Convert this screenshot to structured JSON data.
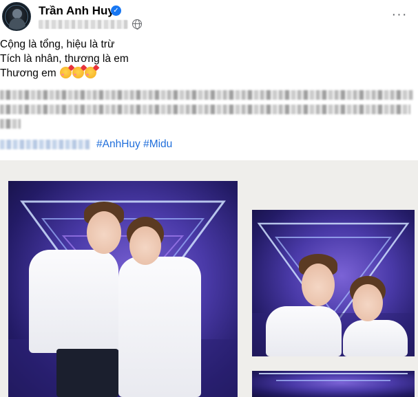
{
  "post": {
    "author": "Trần Anh Huy",
    "verified_icon": "verified-badge-icon",
    "privacy_icon": "globe-icon",
    "more_label": "···",
    "text_lines": [
      "Cộng là tổng, hiệu là trừ",
      "Tích là nhân, thương là em",
      "Thương em"
    ],
    "hashtags": [
      "#AnhHuy",
      "#Midu"
    ]
  },
  "colors": {
    "hashtag": "#216fdb",
    "verified": "#1877f2",
    "media_background": "#efeeeb"
  },
  "media": {
    "photos": [
      {
        "description_icon": "photo-couple-stage-main"
      },
      {
        "description_icon": "photo-couple-stage-side"
      },
      {
        "description_icon": "photo-stage-bottom"
      }
    ]
  }
}
